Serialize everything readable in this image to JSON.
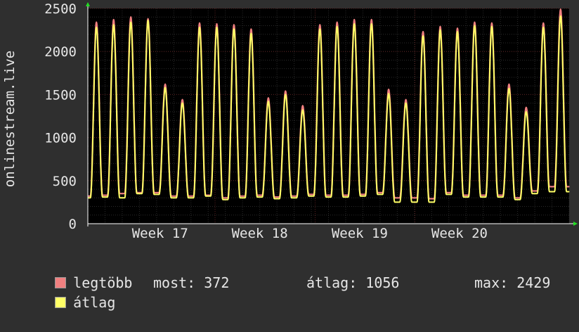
{
  "chart_data": {
    "type": "line",
    "ylabel": "onlinestream.live",
    "ylim": [
      0,
      2500
    ],
    "yticks": [
      0,
      500,
      1000,
      1500,
      2000,
      2500
    ],
    "xticks": [
      {
        "label": "Week 17",
        "at": 0.15
      },
      {
        "label": "Week 18",
        "at": 0.3571
      },
      {
        "label": "Week 19",
        "at": 0.5648
      },
      {
        "label": "Week 20",
        "at": 0.7722
      }
    ],
    "grid": true,
    "colors": {
      "background": "#000000",
      "grid_major": "#5a1f1f",
      "grid_minor": "#2a2a2a",
      "axis": "#ffffff",
      "max_series": "#f08080",
      "avg_series": "#ffff66"
    },
    "series": [
      {
        "name": "legtöbb",
        "color": "#f08080",
        "daily_peaks": [
          2340,
          2370,
          2400,
          2380,
          1620,
          1440,
          2330,
          2320,
          2310,
          2260,
          1460,
          1540,
          1370,
          2310,
          2340,
          2370,
          2370,
          1560,
          1440,
          2230,
          2290,
          2270,
          2340,
          2330,
          1620,
          1350,
          2330,
          2490
        ],
        "daily_troughs": [
          320,
          330,
          350,
          360,
          360,
          320,
          320,
          330,
          300,
          320,
          330,
          310,
          320,
          340,
          330,
          330,
          340,
          360,
          300,
          300,
          290,
          360,
          330,
          330,
          330,
          300,
          380,
          430
        ]
      },
      {
        "name": "átlag",
        "color": "#ffff66",
        "daily_peaks": [
          2280,
          2310,
          2340,
          2360,
          1580,
          1400,
          2280,
          2280,
          2260,
          2210,
          1420,
          1500,
          1320,
          2260,
          2290,
          2320,
          2320,
          1510,
          1400,
          2180,
          2250,
          2230,
          2300,
          2290,
          1570,
          1300,
          2280,
          2410
        ],
        "daily_troughs": [
          300,
          310,
          300,
          350,
          340,
          300,
          300,
          320,
          280,
          300,
          310,
          290,
          300,
          320,
          310,
          310,
          320,
          340,
          250,
          250,
          250,
          340,
          310,
          310,
          310,
          280,
          350,
          372
        ]
      }
    ]
  },
  "legend": {
    "items": [
      {
        "label": "legtöbb",
        "color": "#f08080"
      },
      {
        "label": "átlag",
        "color": "#ffff66"
      }
    ],
    "stats": {
      "now": "most: 372",
      "avg": "átlag: 1056",
      "max": "max: 2429"
    }
  }
}
